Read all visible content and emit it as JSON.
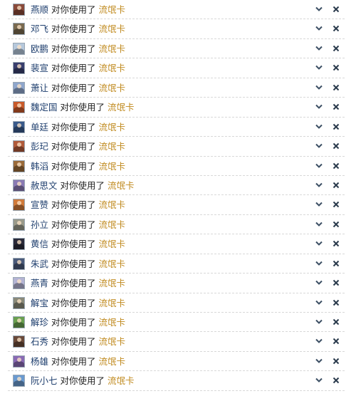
{
  "verb": "对你使用了",
  "card": "流氓卡",
  "icons": {
    "expand": "chevron-down-icon",
    "dismiss": "close-icon"
  },
  "colors": {
    "name": "#1f3f6e",
    "card": "#c08a1e",
    "text": "#222222"
  },
  "notifications": [
    {
      "name": "燕顺",
      "avatar_color": "#8a4a3a"
    },
    {
      "name": "邓飞",
      "avatar_color": "#7a6a50"
    },
    {
      "name": "欧鹏",
      "avatar_color": "#b6c8dc"
    },
    {
      "name": "裴宣",
      "avatar_color": "#3a3f6e"
    },
    {
      "name": "萧让",
      "avatar_color": "#8fa6cc"
    },
    {
      "name": "魏定国",
      "avatar_color": "#c85a2a"
    },
    {
      "name": "单廷",
      "avatar_color": "#3a5a8a"
    },
    {
      "name": "彭玘",
      "avatar_color": "#b05a3a"
    },
    {
      "name": "韩滔",
      "avatar_color": "#9a6a3a"
    },
    {
      "name": "赦思文",
      "avatar_color": "#8a7ab4"
    },
    {
      "name": "宣赞",
      "avatar_color": "#d07a3a"
    },
    {
      "name": "孙立",
      "avatar_color": "#9a9a8a"
    },
    {
      "name": "黄信",
      "avatar_color": "#2a2a3a"
    },
    {
      "name": "朱武",
      "avatar_color": "#4a5a7a"
    },
    {
      "name": "燕青",
      "avatar_color": "#b4b4d4"
    },
    {
      "name": "解宝",
      "avatar_color": "#8a8a7a"
    },
    {
      "name": "解珍",
      "avatar_color": "#6aa050"
    },
    {
      "name": "石秀",
      "avatar_color": "#6a4a3a"
    },
    {
      "name": "杨雄",
      "avatar_color": "#8a6ab4"
    },
    {
      "name": "阮小七",
      "avatar_color": "#6a9ad0"
    }
  ]
}
